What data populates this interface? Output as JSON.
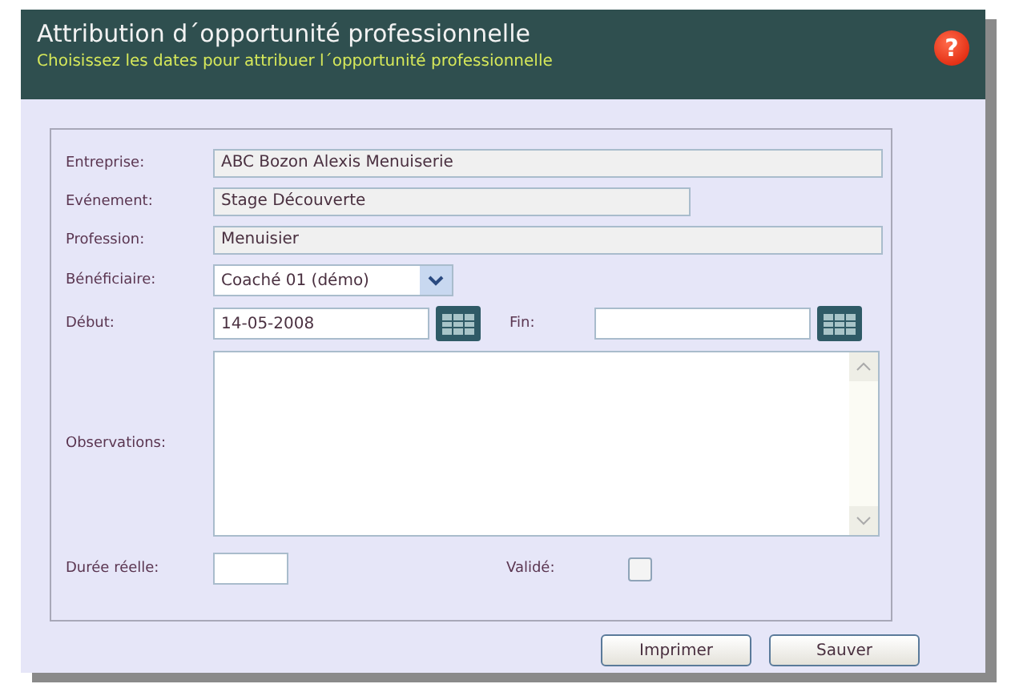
{
  "window": {
    "title": "Attribution d´opportunité professionnelle",
    "subtitle": "Choisissez les dates pour attribuer l´opportunité professionnelle",
    "help": "?"
  },
  "form": {
    "entreprise": {
      "label": "Entreprise:",
      "value": "ABC Bozon Alexis Menuiserie"
    },
    "evenement": {
      "label": "Evénement:",
      "value": "Stage Découverte"
    },
    "profession": {
      "label": "Profession:",
      "value": "Menuisier"
    },
    "beneficiaire": {
      "label": "Bénéficiaire:",
      "value": "Coaché 01 (démo)"
    },
    "debut": {
      "label": "Début:",
      "value": "14-05-2008"
    },
    "fin": {
      "label": "Fin:"
    },
    "observations": {
      "label": "Observations:"
    },
    "duree": {
      "label": "Durée réelle:"
    },
    "valide": {
      "label": "Validé:",
      "checked": false
    }
  },
  "buttons": [
    "Imprimer",
    "Sauver"
  ]
}
